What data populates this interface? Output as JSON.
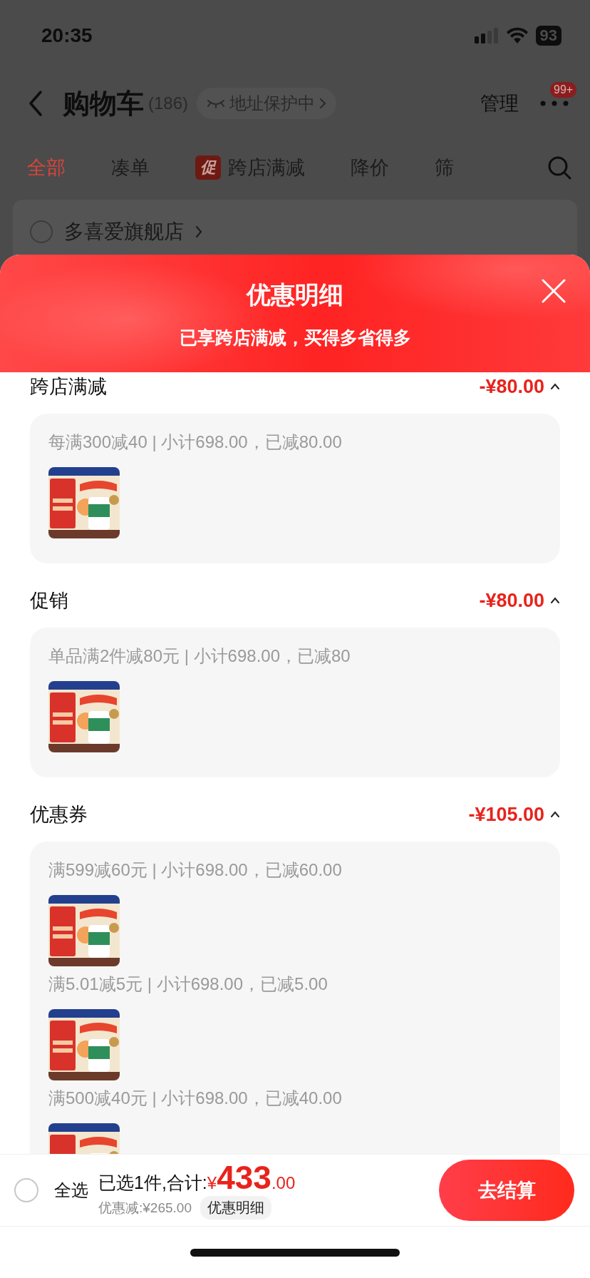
{
  "status_bar": {
    "time": "20:35",
    "battery": "93"
  },
  "nav": {
    "title": "购物车",
    "count": "(186)",
    "privacy_chip": "地址保护中",
    "manage": "管理",
    "badge": "99+"
  },
  "filter_tabs": [
    {
      "label": "全部",
      "selected": true
    },
    {
      "label": "凑单",
      "selected": false
    },
    {
      "label": "跨店满减",
      "selected": false,
      "tag": "促"
    },
    {
      "label": "降价",
      "selected": false
    },
    {
      "label": "筛",
      "selected": false
    }
  ],
  "store": {
    "name": "多喜爱旗舰店",
    "checked": false
  },
  "sheet": {
    "title": "优惠明细",
    "subtitle": "已享跨店满减，买得多省得多",
    "sections": [
      {
        "title": "跨店满减",
        "amount": "-¥80.00",
        "expanded": true,
        "entries": [
          {
            "text": "每满300减40 | 小计698.00，已减80.00"
          }
        ]
      },
      {
        "title": "促销",
        "amount": "-¥80.00",
        "expanded": true,
        "entries": [
          {
            "text": "单品满2件减80元 | 小计698.00，已减80"
          }
        ]
      },
      {
        "title": "优惠券",
        "amount": "-¥105.00",
        "expanded": true,
        "entries": [
          {
            "text": "满599减60元 | 小计698.00，已减60.00"
          },
          {
            "text": "满5.01减5元 | 小计698.00，已减5.00"
          },
          {
            "text": "满500减40元 | 小计698.00，已减40.00"
          }
        ]
      }
    ]
  },
  "footer": {
    "select_all": {
      "label": "全选",
      "checked": false
    },
    "summary": "已选1件,合计:",
    "currency": "¥",
    "total_int": "433",
    "total_dec": ".00",
    "discount": "优惠减:¥265.00",
    "detail_chip": "优惠明细",
    "checkout": "去结算"
  }
}
